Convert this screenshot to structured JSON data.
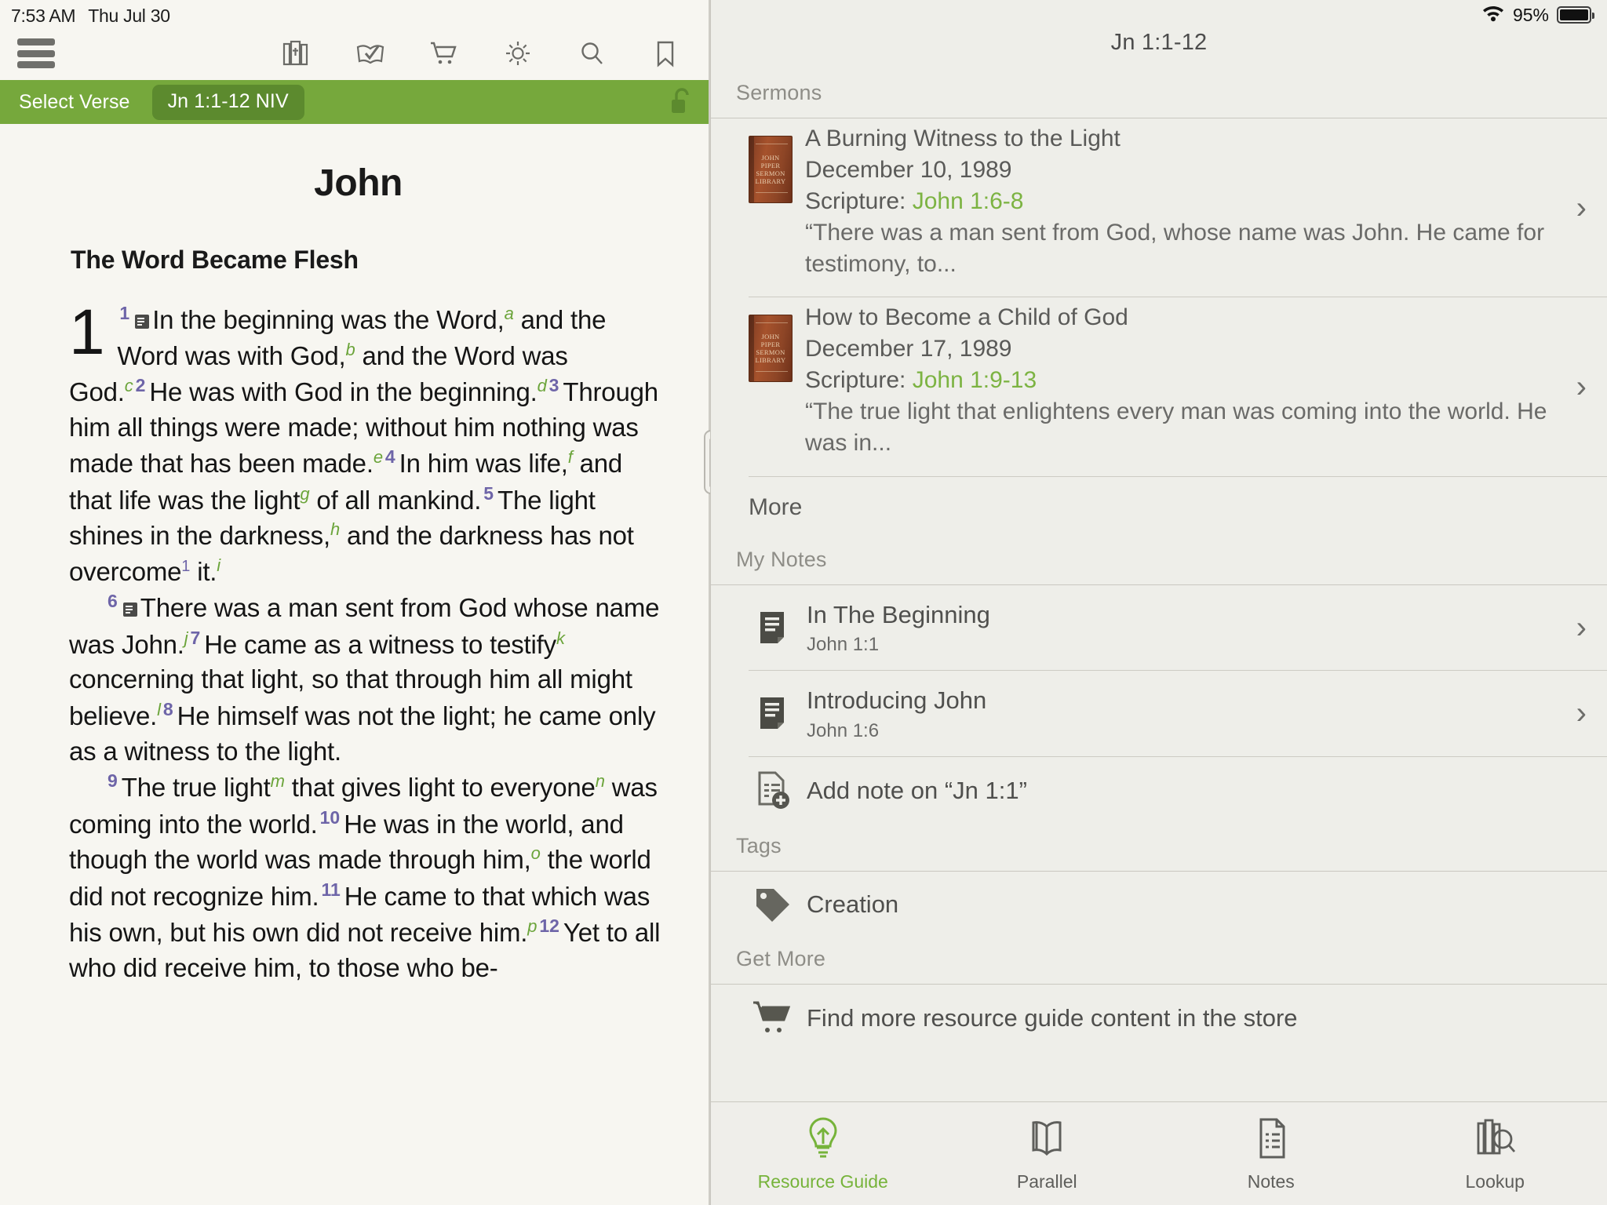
{
  "left": {
    "status": {
      "time": "7:53 AM",
      "date": "Thu Jul 30"
    },
    "toolbar": {
      "menu": "hamburger-menu",
      "icons": [
        {
          "name": "library-icon",
          "label": "Library"
        },
        {
          "name": "reading-plan-icon",
          "label": "Reading Plans"
        },
        {
          "name": "store-cart-icon",
          "label": "Store"
        },
        {
          "name": "gear-icon",
          "label": "Settings"
        },
        {
          "name": "search-icon",
          "label": "Search"
        },
        {
          "name": "bookmark-icon",
          "label": "Bookmarks"
        }
      ]
    },
    "verse_bar": {
      "label": "Select Verse",
      "chip": "Jn 1:1-12 NIV",
      "lock": "unlocked",
      "accent_color": "#76a83c",
      "chip_color": "#5c8a2e"
    },
    "bible": {
      "book_title": "John",
      "section_heading": "The Word Became Flesh",
      "footnote_color": "#6ba43a",
      "verse_number_color": "#6e65a8",
      "paragraphs": [
        {
          "dropcap": "1",
          "runs": [
            {
              "t": "vn",
              "v": "1"
            },
            {
              "t": "note"
            },
            {
              "t": "txt",
              "v": "In the beginning was the Word,"
            },
            {
              "t": "fn",
              "v": "a"
            },
            {
              "t": "txt",
              "v": " and the Word was with God,"
            },
            {
              "t": "fn",
              "v": "b"
            },
            {
              "t": "txt",
              "v": " and the Word was God."
            },
            {
              "t": "fn",
              "v": "c"
            },
            {
              "t": "vn",
              "v": "2"
            },
            {
              "t": "txt",
              "v": "He was with God in the beginning."
            },
            {
              "t": "fn",
              "v": "d"
            },
            {
              "t": "vn",
              "v": "3"
            },
            {
              "t": "txt",
              "v": "Through him all things were made; without him nothing was made that has been made."
            },
            {
              "t": "fn",
              "v": "e"
            },
            {
              "t": "vn",
              "v": "4"
            },
            {
              "t": "txt",
              "v": "In him was life,"
            },
            {
              "t": "fn",
              "v": "f"
            },
            {
              "t": "txt",
              "v": " and that life was the light"
            },
            {
              "t": "fn",
              "v": "g"
            },
            {
              "t": "txt",
              "v": " of all mankind."
            },
            {
              "t": "vn",
              "v": "5"
            },
            {
              "t": "txt",
              "v": "The light shines in the darkness,"
            },
            {
              "t": "fn",
              "v": "h"
            },
            {
              "t": "txt",
              "v": " and the darkness has not overcome"
            },
            {
              "t": "fnn",
              "v": "1"
            },
            {
              "t": "txt",
              "v": " it."
            },
            {
              "t": "fn",
              "v": "i"
            }
          ]
        },
        {
          "indent": true,
          "runs": [
            {
              "t": "vn",
              "v": "6"
            },
            {
              "t": "note"
            },
            {
              "t": "txt",
              "v": "There was a man sent from God whose name was John."
            },
            {
              "t": "fn",
              "v": "j"
            },
            {
              "t": "vn",
              "v": "7"
            },
            {
              "t": "txt",
              "v": "He came as a witness to testify"
            },
            {
              "t": "fn",
              "v": "k"
            },
            {
              "t": "txt",
              "v": " concerning that light, so that through him all might believe."
            },
            {
              "t": "fn",
              "v": "l"
            },
            {
              "t": "vn",
              "v": "8"
            },
            {
              "t": "txt",
              "v": "He himself was not the light; he came only as a witness to the light."
            }
          ]
        },
        {
          "indent": true,
          "runs": [
            {
              "t": "vn",
              "v": "9"
            },
            {
              "t": "txt",
              "v": "The true light"
            },
            {
              "t": "fn",
              "v": "m"
            },
            {
              "t": "txt",
              "v": " that gives light to everyone"
            },
            {
              "t": "fn",
              "v": "n"
            },
            {
              "t": "txt",
              "v": " was coming into the world."
            },
            {
              "t": "vn",
              "v": "10"
            },
            {
              "t": "txt",
              "v": "He was in the world, and though the world was made through him,"
            },
            {
              "t": "fn",
              "v": "o"
            },
            {
              "t": "txt",
              "v": " the world did not recognize him."
            },
            {
              "t": "vn",
              "v": "11"
            },
            {
              "t": "txt",
              "v": "He came to that which was his own, but his own did not receive him."
            },
            {
              "t": "fn",
              "v": "p"
            },
            {
              "t": "vn",
              "v": "12"
            },
            {
              "t": "txt",
              "v": "Yet to all who did receive him, to those who be-"
            }
          ]
        }
      ]
    }
  },
  "right": {
    "status": {
      "battery_percent": "95%",
      "wifi": "wifi-icon"
    },
    "title": "Jn 1:1-12",
    "groups": [
      {
        "heading": "Sermons",
        "type": "sermons",
        "items": [
          {
            "title": "A Burning Witness to the Light",
            "date": "December 10, 1989",
            "scripture_label": "Scripture: ",
            "scripture_ref": "John 1:6-8",
            "quote": "“There was a man sent from God, whose name was John. He came for testimony, to...",
            "cover": [
              "JOHN",
              "PIPER",
              "SERMON",
              "LIBRARY"
            ]
          },
          {
            "title": "How to Become a Child of God",
            "date": "December 17, 1989",
            "scripture_label": "Scripture: ",
            "scripture_ref": "John 1:9-13",
            "quote": "“The true light that enlightens every man was coming into the world. He was in...",
            "cover": [
              "JOHN",
              "PIPER",
              "SERMON",
              "LIBRARY"
            ]
          }
        ],
        "more_label": "More"
      },
      {
        "heading": "My Notes",
        "type": "notes",
        "items": [
          {
            "title": "In The Beginning",
            "ref": "John 1:1",
            "icon": "note-icon",
            "chevron": true
          },
          {
            "title": "Introducing John",
            "ref": "John 1:6",
            "icon": "note-icon",
            "chevron": true
          },
          {
            "title": "Add note on “Jn 1:1”",
            "ref": "",
            "icon": "add-note-icon",
            "chevron": false
          }
        ]
      },
      {
        "heading": "Tags",
        "type": "tags",
        "items": [
          {
            "title": "Creation",
            "icon": "tag-icon"
          }
        ]
      },
      {
        "heading": "Get More",
        "type": "store",
        "items": [
          {
            "title": "Find more resource guide content in the store",
            "icon": "cart-icon"
          }
        ]
      }
    ],
    "tabs": [
      {
        "label": "Resource Guide",
        "icon": "lightbulb-icon",
        "active": true
      },
      {
        "label": "Parallel",
        "icon": "open-book-icon",
        "active": false
      },
      {
        "label": "Notes",
        "icon": "document-icon",
        "active": false
      },
      {
        "label": "Lookup",
        "icon": "books-search-icon",
        "active": false
      }
    ],
    "accent_color": "#76b33a"
  }
}
